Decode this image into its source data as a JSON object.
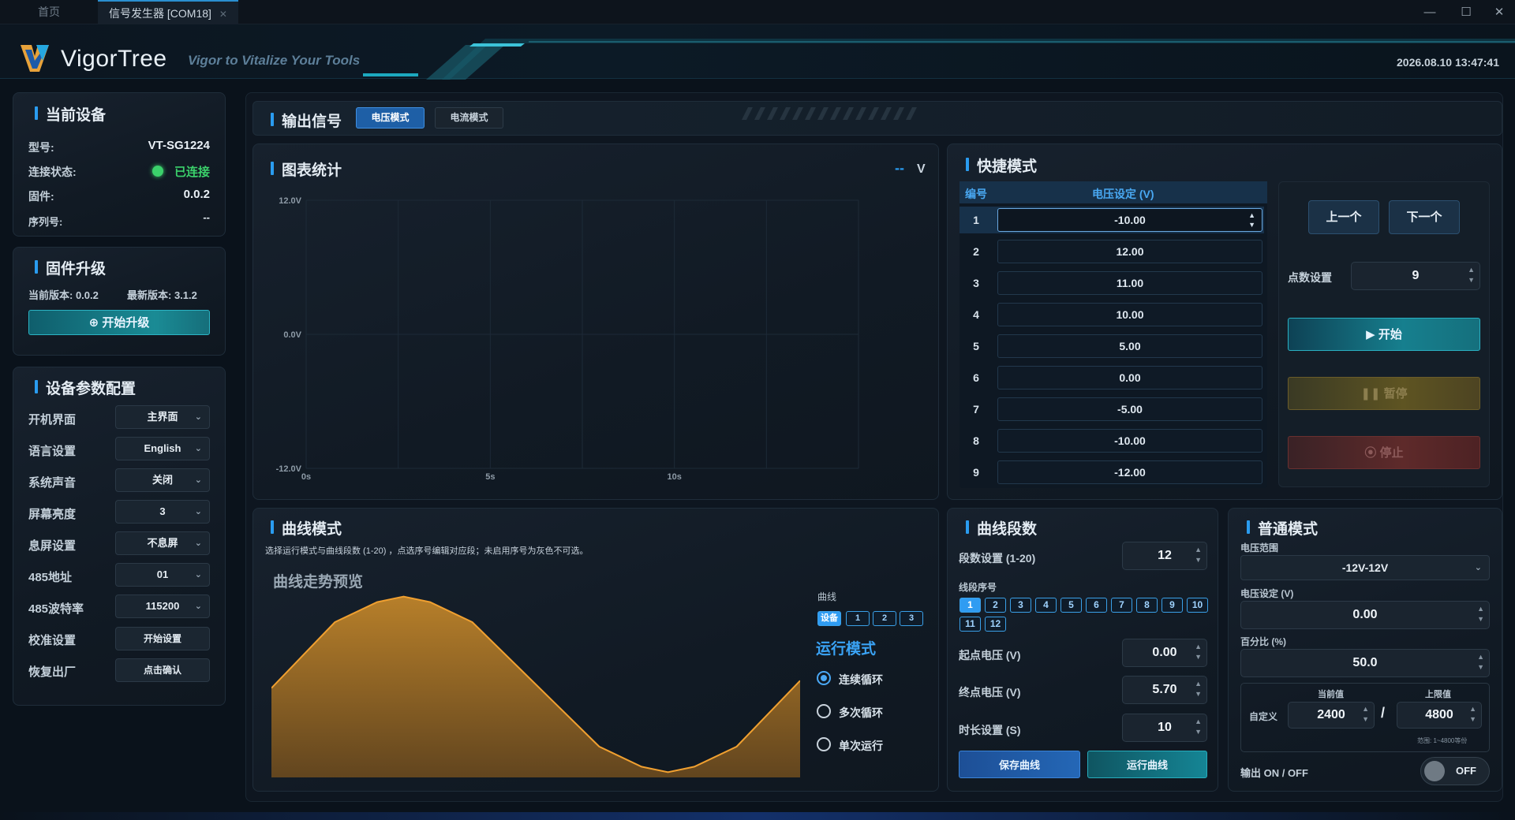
{
  "tabs": [
    {
      "label": "首页"
    },
    {
      "label": "信号发生器 [COM18]"
    }
  ],
  "header": {
    "brand": "VigorTree",
    "slogan": "Vigor to Vitalize Your Tools",
    "datetime": "2026.08.10 13:47:41"
  },
  "device": {
    "title": "当前设备",
    "rows": [
      {
        "label": "型号:",
        "value": "VT-SG1224"
      },
      {
        "label": "连接状态:",
        "value": "已连接"
      },
      {
        "label": "固件:",
        "value": "0.0.2"
      },
      {
        "label": "序列号:",
        "value": "--"
      }
    ]
  },
  "firmware": {
    "title": "固件升级",
    "current": "当前版本: 0.0.2",
    "latest": "最新版本: 3.1.2",
    "button": "开始升级"
  },
  "params": {
    "title": "设备参数配置",
    "rows": [
      {
        "label": "开机界面",
        "value": "主界面",
        "type": "select"
      },
      {
        "label": "语言设置",
        "value": "English",
        "type": "select"
      },
      {
        "label": "系统声音",
        "value": "关闭",
        "type": "select"
      },
      {
        "label": "屏幕亮度",
        "value": "3",
        "type": "select"
      },
      {
        "label": "息屏设置",
        "value": "不息屏",
        "type": "select"
      },
      {
        "label": "485地址",
        "value": "01",
        "type": "select"
      },
      {
        "label": "485波特率",
        "value": "115200",
        "type": "select"
      },
      {
        "label": "校准设置",
        "value": "开始设置",
        "type": "button"
      },
      {
        "label": "恢复出厂",
        "value": "点击确认",
        "type": "button"
      }
    ]
  },
  "output": {
    "title": "输出信号",
    "mode_voltage": "电压模式",
    "mode_current": "电流模式"
  },
  "chart": {
    "title": "图表统计",
    "unit": "V",
    "legend_dash": "--"
  },
  "chart_data": {
    "type": "line",
    "series": [],
    "yticks": [
      "12.0V",
      "0.0V",
      "-12.0V"
    ],
    "xticks": [
      "0s",
      "5s",
      "10s"
    ],
    "ylim": [
      -12,
      12
    ],
    "xlim": [
      0,
      15
    ],
    "grid": true
  },
  "quick": {
    "title": "快捷模式",
    "col_no": "编号",
    "col_voltage": "电压设定 (V)",
    "rows": [
      {
        "no": "1",
        "v": "-10.00"
      },
      {
        "no": "2",
        "v": "12.00"
      },
      {
        "no": "3",
        "v": "11.00"
      },
      {
        "no": "4",
        "v": "10.00"
      },
      {
        "no": "5",
        "v": "5.00"
      },
      {
        "no": "6",
        "v": "0.00"
      },
      {
        "no": "7",
        "v": "-5.00"
      },
      {
        "no": "8",
        "v": "-10.00"
      },
      {
        "no": "9",
        "v": "-12.00"
      }
    ],
    "prev": "上一个",
    "next": "下一个",
    "points_label": "点数设置",
    "points_value": "9",
    "start": "开始",
    "pause": "暂停",
    "stop": "停止"
  },
  "curve": {
    "title": "曲线模式",
    "desc": "选择运行模式与曲线段数 (1-20) ，点选序号编辑对应段；未启用序号为灰色不可选。",
    "preview": "曲线走势预览",
    "curve_label": "曲线",
    "curve_tabs": [
      "设备",
      "1",
      "2",
      "3"
    ],
    "run_title": "运行模式",
    "runs": [
      {
        "label": "连续循环"
      },
      {
        "label": "多次循环"
      },
      {
        "label": "单次运行"
      }
    ],
    "preview_points": [
      [
        0,
        0.52
      ],
      [
        0.12,
        0.16
      ],
      [
        0.2,
        0.05
      ],
      [
        0.25,
        0.02
      ],
      [
        0.3,
        0.05
      ],
      [
        0.38,
        0.16
      ],
      [
        0.5,
        0.5
      ],
      [
        0.62,
        0.84
      ],
      [
        0.7,
        0.95
      ],
      [
        0.75,
        0.98
      ],
      [
        0.8,
        0.95
      ],
      [
        0.88,
        0.84
      ],
      [
        1,
        0.48
      ]
    ]
  },
  "segments": {
    "title": "曲线段数",
    "count_label": "段数设置 (1-20)",
    "count": "12",
    "seq_label": "线段序号",
    "seq": [
      "1",
      "2",
      "3",
      "4",
      "5",
      "6",
      "7",
      "8",
      "9",
      "10",
      "11",
      "12"
    ],
    "start_label": "起点电压 (V)",
    "start": "0.00",
    "end_label": "终点电压 (V)",
    "end": "5.70",
    "dur_label": "时长设置 (S)",
    "dur": "10",
    "save": "保存曲线",
    "run": "运行曲线"
  },
  "normal": {
    "title": "普通模式",
    "range_label": "电压范围",
    "range": "-12V-12V",
    "vset_label": "电压设定 (V)",
    "vset": "0.00",
    "pct_label": "百分比 (%)",
    "pct": "50.0",
    "custom": "自定义",
    "cur_label": "当前值",
    "cur": "2400",
    "max_label": "上限值",
    "max": "4800",
    "range_hint": "范围: 1~4800等份",
    "out_label": "输出 ON / OFF",
    "out": "OFF"
  }
}
